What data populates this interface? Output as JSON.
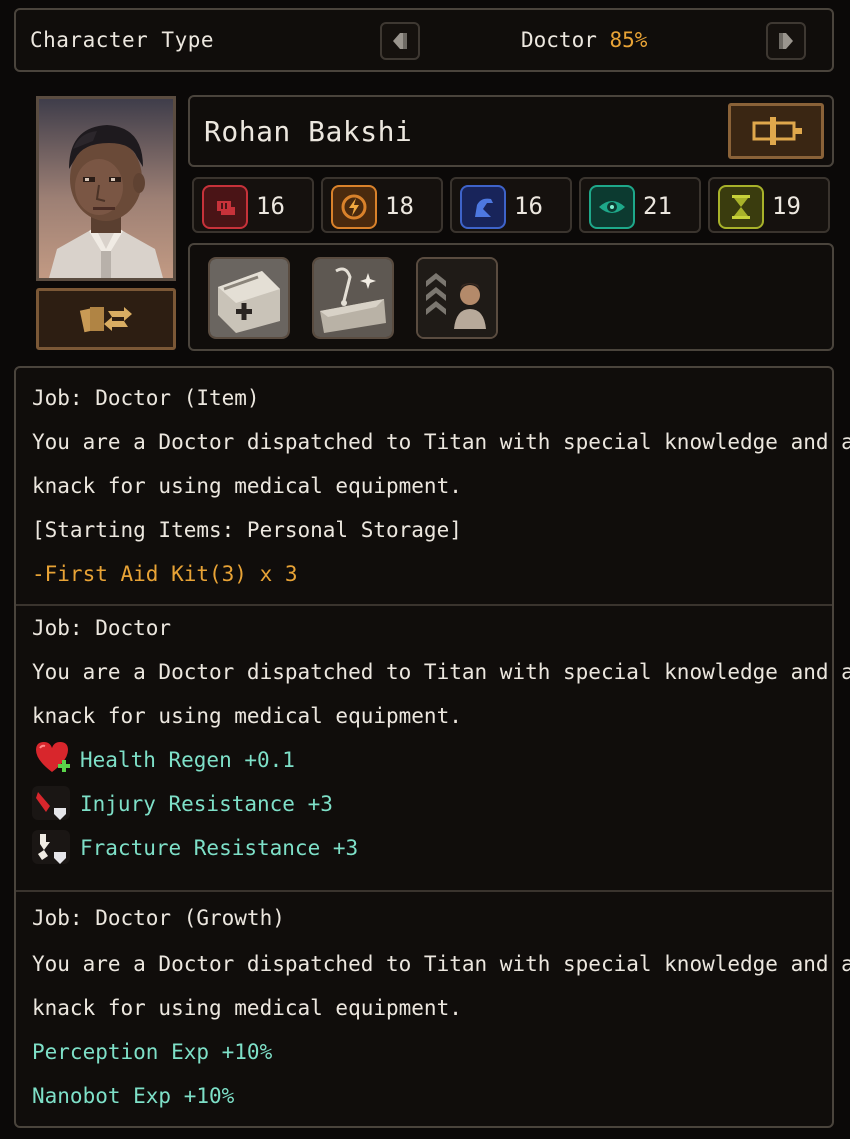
{
  "header": {
    "title": "Character Type",
    "type_name": "Doctor",
    "type_percent": "85%"
  },
  "character": {
    "name": "Rohan Bakshi"
  },
  "stats": [
    {
      "icon": "strength-fist-icon",
      "color": "#c7323a",
      "value": "16"
    },
    {
      "icon": "agility-lightning-icon",
      "color": "#d9822b",
      "value": "18"
    },
    {
      "icon": "intelligence-head-icon",
      "color": "#3e63c9",
      "value": "16"
    },
    {
      "icon": "perception-eye-icon",
      "color": "#1ea88a",
      "value": "21"
    },
    {
      "icon": "endurance-hourglass-icon",
      "color": "#a8b22a",
      "value": "19"
    }
  ],
  "traits": [
    "first-aid-kit-icon",
    "medical-tools-icon",
    "rank-up-person-icon"
  ],
  "sections": [
    {
      "title": "Job: Doctor (Item)",
      "desc1": "You are a Doctor dispatched to Titan with special knowledge and a",
      "desc2": "knack for using medical equipment.",
      "extra": "[Starting Items: Personal Storage]",
      "item": "-First Aid Kit(3) x 3"
    },
    {
      "title": "Job: Doctor",
      "desc1": "You are a Doctor dispatched to Titan with special knowledge and a",
      "desc2": "knack for using medical equipment.",
      "bonuses": [
        {
          "icon": "health-regen-heart-icon",
          "text": "Health Regen +0.1"
        },
        {
          "icon": "injury-resistance-icon",
          "text": "Injury Resistance +3"
        },
        {
          "icon": "fracture-resistance-icon",
          "text": "Fracture Resistance +3"
        }
      ]
    },
    {
      "title": "Job: Doctor (Growth)",
      "desc1": "You are a Doctor dispatched to Titan with special knowledge and a",
      "desc2": "knack for using medical equipment.",
      "growth1": "Perception Exp +10%",
      "growth2": "Nanobot Exp +10%"
    }
  ],
  "colors": {
    "accent_orange": "#e8a336",
    "bonus_teal": "#7ee0c8",
    "panel_border": "#4a443c"
  }
}
